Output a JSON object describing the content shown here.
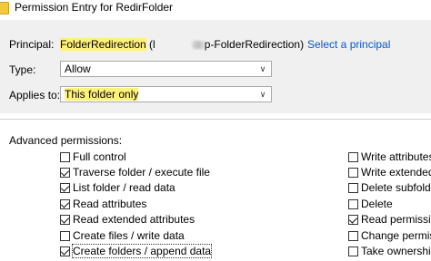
{
  "window": {
    "title": "Permission Entry for RedirFolder"
  },
  "principal": {
    "label": "Principal:",
    "name_highlighted": "FolderRedirection",
    "name_rest": " (l",
    "name_second": "p-FolderRedirection)",
    "select_link": "Select a principal"
  },
  "type": {
    "label": "Type:",
    "value": "Allow"
  },
  "applies_to": {
    "label": "Applies to:",
    "value": "This folder only"
  },
  "advanced": {
    "label": "Advanced permissions:",
    "left": [
      {
        "label": "Full control",
        "checked": false
      },
      {
        "label": "Traverse folder / execute file",
        "checked": true
      },
      {
        "label": "List folder / read data",
        "checked": true
      },
      {
        "label": "Read attributes",
        "checked": true
      },
      {
        "label": "Read extended attributes",
        "checked": true
      },
      {
        "label": "Create files / write data",
        "checked": false
      },
      {
        "label": "Create folders / append data",
        "checked": true,
        "focused": true
      }
    ],
    "right": [
      {
        "label": "Write attributes",
        "checked": false
      },
      {
        "label": "Write extended at",
        "checked": false
      },
      {
        "label": "Delete subfolders",
        "checked": false
      },
      {
        "label": "Delete",
        "checked": false
      },
      {
        "label": "Read permissions",
        "checked": true
      },
      {
        "label": "Change permissio",
        "checked": false
      },
      {
        "label": "Take ownership",
        "checked": false
      }
    ]
  }
}
